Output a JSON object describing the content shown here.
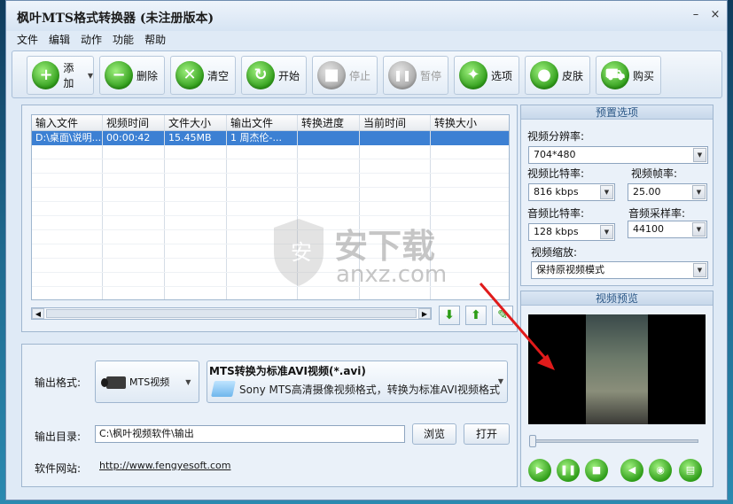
{
  "window": {
    "title": "枫叶MTS格式转换器  (未注册版本)",
    "minimize": "–",
    "close": "×"
  },
  "menu": [
    "文件",
    "编辑",
    "动作",
    "功能",
    "帮助"
  ],
  "toolbar": [
    {
      "label": "添加",
      "icon": "add-icon",
      "glyph": "+",
      "enabled": true,
      "dropdown": true
    },
    {
      "label": "删除",
      "icon": "remove-icon",
      "glyph": "−",
      "enabled": true
    },
    {
      "label": "清空",
      "icon": "clear-icon",
      "glyph": "✕",
      "enabled": true
    },
    {
      "label": "开始",
      "icon": "start-icon",
      "glyph": "↻",
      "enabled": true
    },
    {
      "label": "停止",
      "icon": "stop-icon",
      "glyph": "■",
      "enabled": false
    },
    {
      "label": "暂停",
      "icon": "pause-icon",
      "glyph": "❚❚",
      "enabled": false
    },
    {
      "label": "选项",
      "icon": "options-icon",
      "glyph": "✦",
      "enabled": true
    },
    {
      "label": "皮肤",
      "icon": "skin-icon",
      "glyph": "●",
      "enabled": true
    },
    {
      "label": "购买",
      "icon": "cart-icon",
      "glyph": "⛟",
      "enabled": true
    }
  ],
  "file_list": {
    "columns": [
      "输入文件",
      "视频时间",
      "文件大小",
      "输出文件",
      "转换进度",
      "当前时间",
      "转换大小"
    ],
    "rows": [
      [
        "D:\\桌面\\说明...",
        "00:00:42",
        "15.45MB",
        "1 周杰伦-...",
        "",
        "",
        ""
      ]
    ]
  },
  "output": {
    "format_label": "输出格式:",
    "format_value": "MTS视频",
    "format_title": "MTS转换为标准AVI视频(*.avi)",
    "format_desc": "Sony MTS高清摄像视频格式，转换为标准AVI视频格式",
    "dir_label": "输出目录:",
    "dir_value": "C:\\枫叶视频软件\\输出",
    "browse": "浏览",
    "open": "打开",
    "site_label": "软件网站:",
    "site_url": "http://www.fengyesoft.com"
  },
  "preset": {
    "title": "预置选项",
    "resolution_label": "视频分辨率:",
    "resolution": "704*480",
    "vbitrate_label": "视频比特率:",
    "vbitrate": "816 kbps",
    "fps_label": "视频帧率:",
    "fps": "25.00",
    "abitrate_label": "音频比特率:",
    "abitrate": "128 kbps",
    "samplerate_label": "音频采样率:",
    "samplerate": "44100",
    "scale_label": "视频缩放:",
    "scale": "保持原视频模式"
  },
  "preview": {
    "title": "视频预览",
    "position": 0
  },
  "watermark": {
    "text": "安下载",
    "sub": "anxz.com"
  }
}
